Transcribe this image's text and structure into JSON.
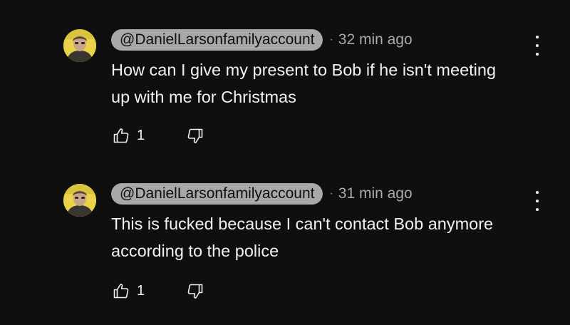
{
  "comments": [
    {
      "author": "@DanielLarsonfamilyaccount",
      "separator": "·",
      "time": "32 min ago",
      "text": "How can I give my present to Bob if he isn't meeting up with me for Christmas",
      "likes": "1",
      "icons": {
        "like": "thumbs-up-icon",
        "dislike": "thumbs-down-icon",
        "menu": "more-vertical-icon"
      }
    },
    {
      "author": "@DanielLarsonfamilyaccount",
      "separator": "·",
      "time": "31 min ago",
      "text": "This is fucked because I can't contact Bob anymore according to the police",
      "likes": "1",
      "icons": {
        "like": "thumbs-up-icon",
        "dislike": "thumbs-down-icon",
        "menu": "more-vertical-icon"
      }
    }
  ],
  "colors": {
    "background": "#0f0f0f",
    "text": "#f1f1f1",
    "secondary": "#aaaaaa",
    "handle_pill": "#a8a8a8",
    "avatar_bg": "#e8d34a"
  }
}
